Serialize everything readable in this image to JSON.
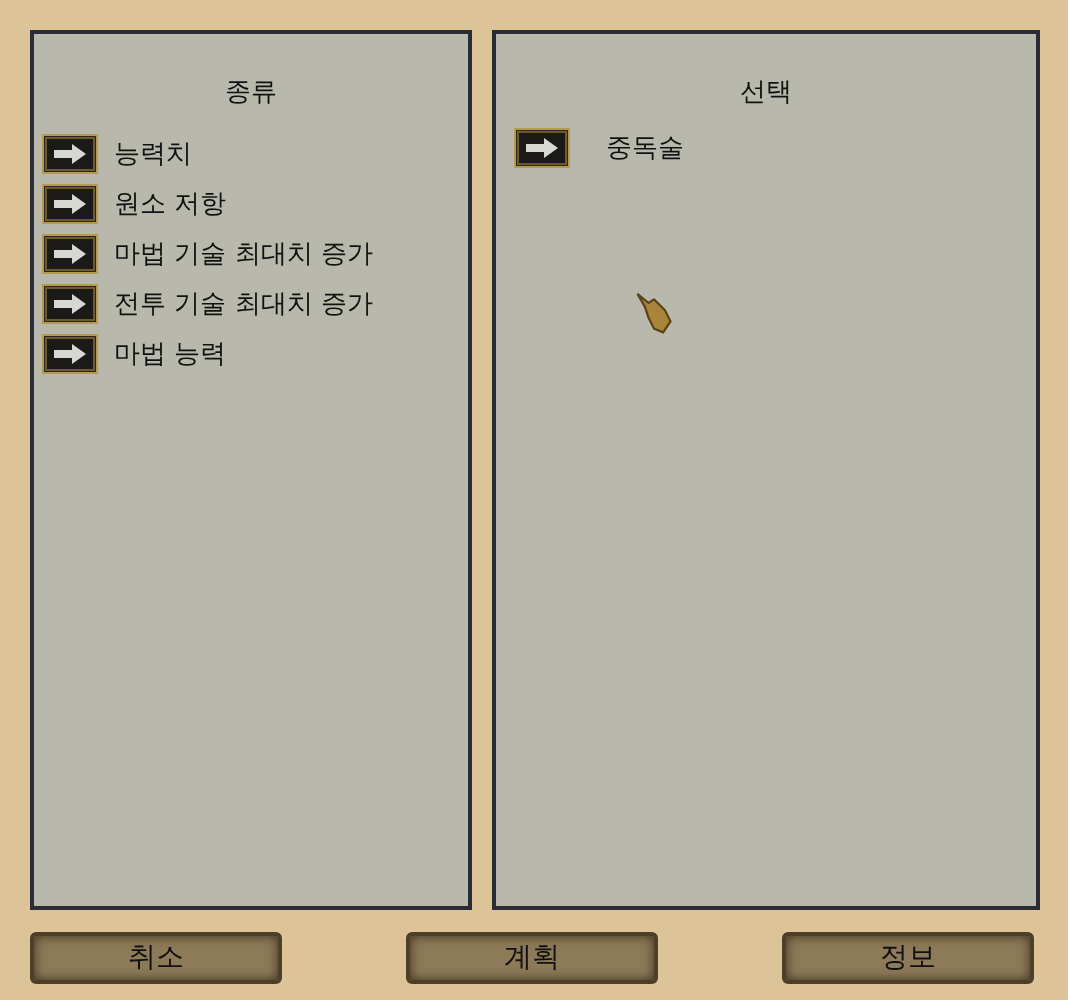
{
  "categories": {
    "heading": "종류",
    "items": [
      {
        "label": "능력치"
      },
      {
        "label": "원소 저항"
      },
      {
        "label": "마법 기술 최대치 증가"
      },
      {
        "label": "전투 기술 최대치 증가"
      },
      {
        "label": "마법 능력"
      }
    ]
  },
  "selection": {
    "heading": "선택",
    "items": [
      {
        "label": "중독술"
      }
    ]
  },
  "buttons": [
    "취소",
    "계획",
    "정보"
  ]
}
